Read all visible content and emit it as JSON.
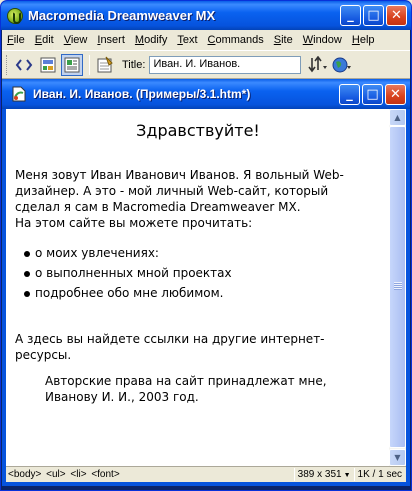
{
  "app": {
    "title": "Macromedia Dreamweaver MX",
    "caption": {
      "minimize": "_",
      "maximize": "□",
      "close": "✕"
    }
  },
  "menu": [
    {
      "prefix": "",
      "accel": "F",
      "rest": "ile"
    },
    {
      "prefix": "",
      "accel": "E",
      "rest": "dit"
    },
    {
      "prefix": "",
      "accel": "V",
      "rest": "iew"
    },
    {
      "prefix": "",
      "accel": "I",
      "rest": "nsert"
    },
    {
      "prefix": "",
      "accel": "M",
      "rest": "odify"
    },
    {
      "prefix": "",
      "accel": "T",
      "rest": "ext"
    },
    {
      "prefix": "",
      "accel": "C",
      "rest": "ommands"
    },
    {
      "prefix": "",
      "accel": "S",
      "rest": "ite"
    },
    {
      "prefix": "",
      "accel": "W",
      "rest": "indow"
    },
    {
      "prefix": "",
      "accel": "H",
      "rest": "elp"
    }
  ],
  "toolbar": {
    "title_label": "Title:",
    "title_value": "Иван. И. Иванов."
  },
  "document": {
    "window_title": "Иван. И. Иванов. (Примеры/3.1.htm*)",
    "heading": "Здравствуйте!",
    "intro_line1": "Меня зовут Иван Иванович Иванов. Я вольный Web-",
    "intro_line2": "дизайнер. А это - мой личный Web-сайт, который",
    "intro_line3": "сделал я сам в Macromedia Dreamweaver MX.",
    "intro_line4": "На этом сайте вы можете прочитать:",
    "bullets": [
      "о моих увлечениях:",
      "о выполненных мной проектах",
      "подробнее обо мне любимом."
    ],
    "links_line1": "А здесь вы найдете ссылки на другие интернет-",
    "links_line2": "ресурсы.",
    "copyright_line1": "Авторские права на сайт принадлежат мне,",
    "copyright_line2": "Иванову И. И., 2003 год."
  },
  "status": {
    "tags": [
      "<body>",
      "<ul>",
      "<li>",
      "<font>"
    ],
    "dimensions": "389 x 351",
    "size_time": "1K / 1 sec"
  },
  "colors": {
    "titlebar": "#0653dd",
    "close_button": "#d8411c",
    "chrome": "#ece9d8"
  }
}
